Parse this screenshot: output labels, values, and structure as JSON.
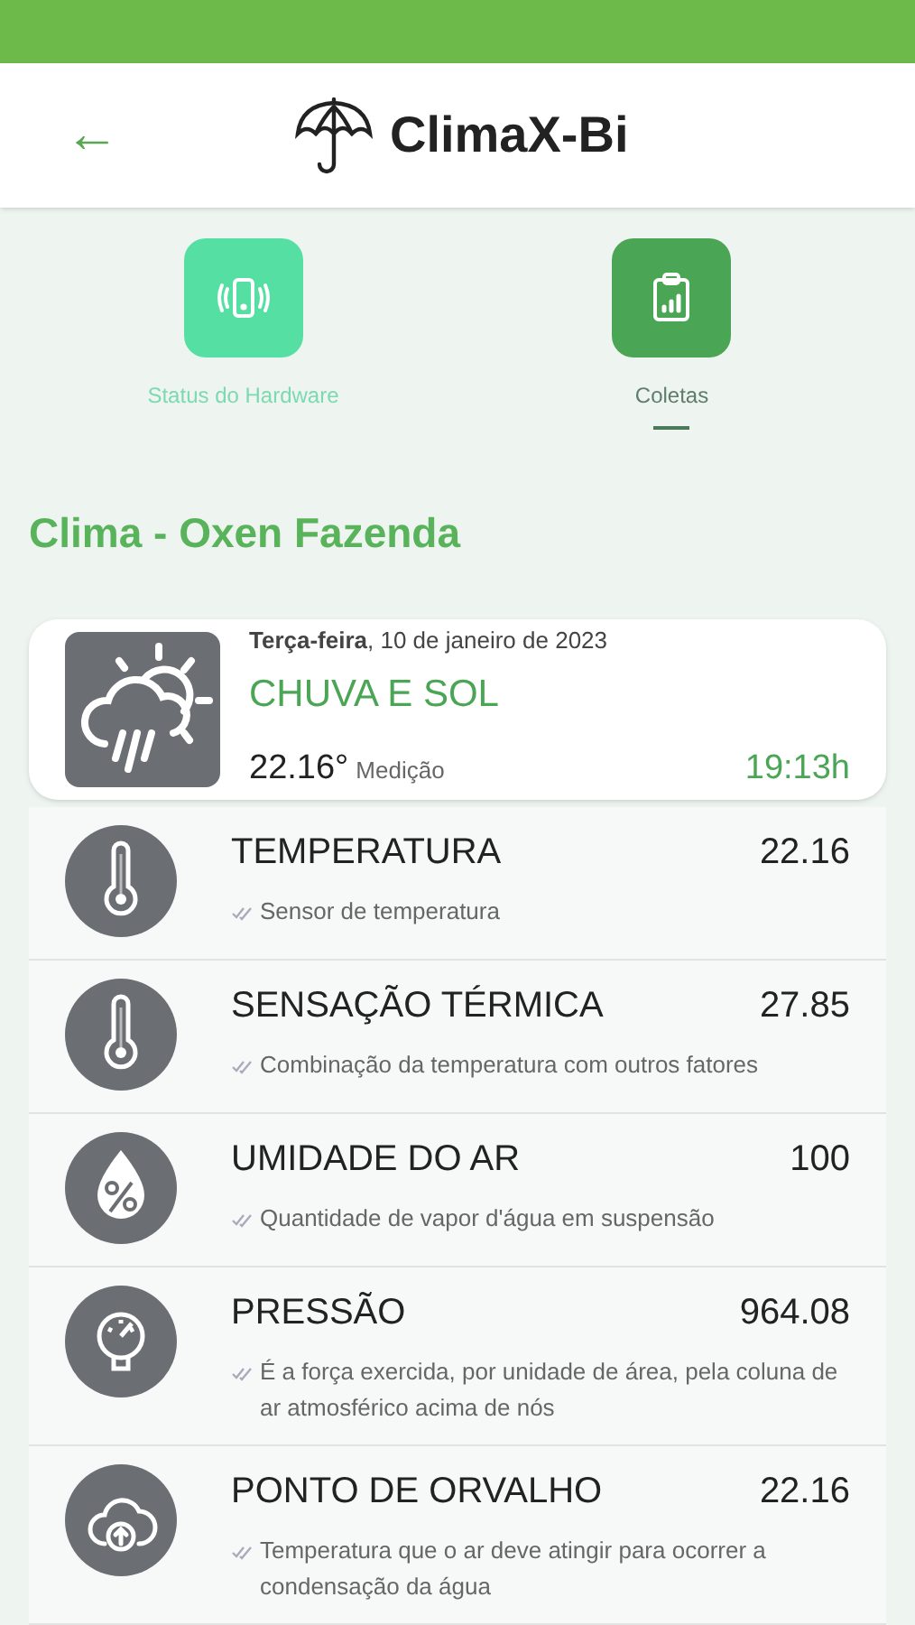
{
  "header": {
    "back": "←",
    "title": "ClimaX-Bi"
  },
  "tabs": [
    {
      "label": "Status do Hardware",
      "kind": "hardware",
      "selected": false
    },
    {
      "label": "Coletas",
      "kind": "collections",
      "selected": true
    }
  ],
  "section_title": "Clima - Oxen Fazenda",
  "summary": {
    "date": "**Terça-feira**, 10 de janeiro de 2023",
    "condition": "CHUVA E SOL",
    "temperature": "22.16°",
    "temperature_label": "Medição",
    "time": "19:13h"
  },
  "readings": [
    {
      "kind": "thermometer",
      "name": "TEMPERATURA",
      "value": "22.16",
      "description": "Sensor de temperatura"
    },
    {
      "kind": "thermometer",
      "name": "SENSAÇÃO TÉRMICA",
      "value": "27.85",
      "description": "Combinação da temperatura com outros fatores"
    },
    {
      "kind": "humidity",
      "name": "UMIDADE DO AR",
      "value": "100",
      "description": "Quantidade de vapor d'água em suspensão"
    },
    {
      "kind": "gauge",
      "name": "PRESSÃO",
      "value": "964.08",
      "description": "É a força exercida, por unidade de área, pela coluna de ar atmosférico acima de nós"
    },
    {
      "kind": "cloud",
      "name": "PONTO DE ORVALHO",
      "value": "22.16",
      "description": "Temperatura que o ar deve atingir para ocorrer a condensação da água"
    }
  ]
}
